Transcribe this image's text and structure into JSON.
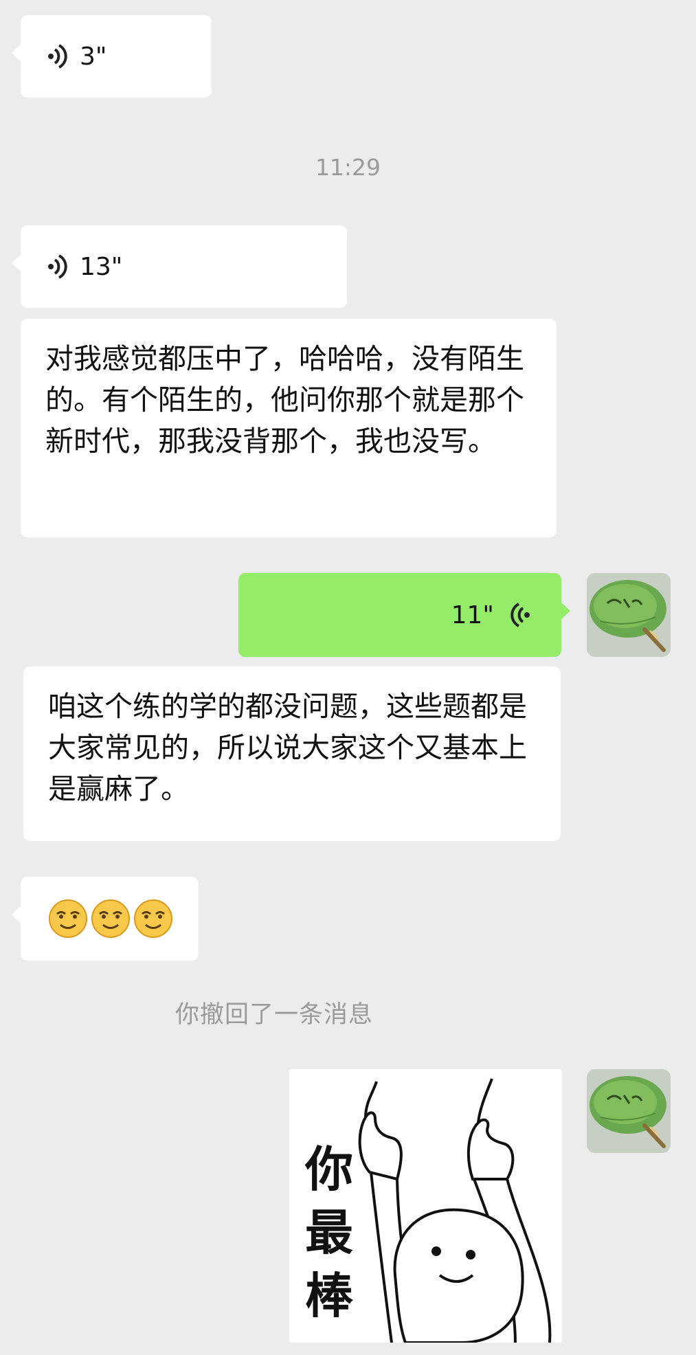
{
  "colors": {
    "chat_background": "#ececec",
    "incoming_bubble": "#ffffff",
    "outgoing_bubble": "#95ec69",
    "system_text": "#9a9a9a"
  },
  "timestamp": "11:29",
  "messages": [
    {
      "kind": "voice",
      "direction": "incoming",
      "duration": "3\""
    },
    {
      "kind": "voice",
      "direction": "incoming",
      "duration": "13\""
    },
    {
      "kind": "text",
      "direction": "incoming",
      "text": "对我感觉都压中了，哈哈哈，没有陌生的。有个陌生的，他问你那个就是那个新时代，那我没背那个，我也没写。"
    },
    {
      "kind": "voice",
      "direction": "outgoing",
      "duration": "11\""
    },
    {
      "kind": "text",
      "direction": "incoming",
      "text": "咱这个练的学的都没问题，这些题都是大家常见的，所以说大家这个又基本上是赢麻了。"
    },
    {
      "kind": "emoji",
      "direction": "incoming",
      "emoji": [
        "smirk-emoji",
        "smirk-emoji",
        "smirk-emoji"
      ]
    },
    {
      "kind": "sticker",
      "direction": "outgoing",
      "caption": "你最棒"
    }
  ],
  "system_notice": "你撤回了一条消息",
  "avatar": {
    "icon": "green-fan-avatar"
  }
}
